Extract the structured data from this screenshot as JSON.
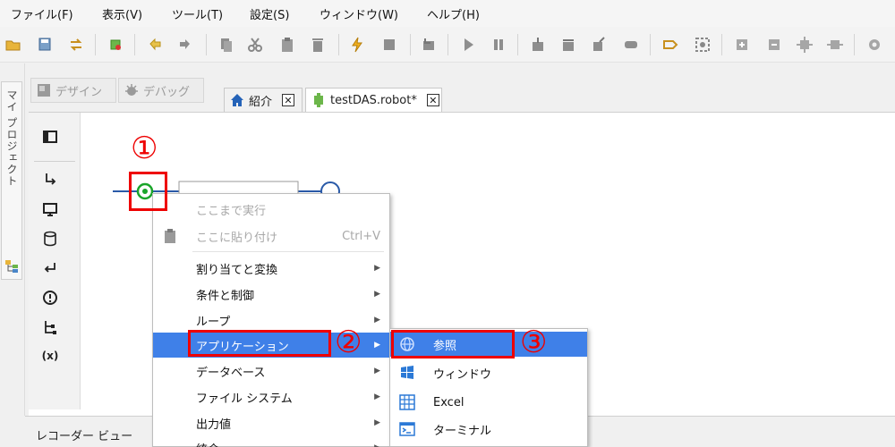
{
  "menubar": {
    "items": [
      {
        "label": "ファイル(F)"
      },
      {
        "label": "表示(V)"
      },
      {
        "label": "ツール(T)"
      },
      {
        "label": "設定(S)"
      },
      {
        "label": "ウィンドウ(W)"
      },
      {
        "label": "ヘルプ(H)"
      }
    ]
  },
  "left_panel": {
    "project_tab": "マイ プロジェクト"
  },
  "perspectives": {
    "design": "デザイン",
    "debug": "デバッグ"
  },
  "editor_tabs": [
    {
      "label": "紹介",
      "close": "✕"
    },
    {
      "label": "testDAS.robot*",
      "close": "✕"
    }
  ],
  "palette": {
    "variables_label": "(x)"
  },
  "recorder": {
    "title": "レコーダー ビュー"
  },
  "context_menu": {
    "items": [
      {
        "label": "ここまで実行",
        "shortcut": ""
      },
      {
        "label": "ここに貼り付け",
        "shortcut": "Ctrl+V"
      },
      {
        "label": "割り当てと変換",
        "arrow": "▶"
      },
      {
        "label": "条件と制御",
        "arrow": "▶"
      },
      {
        "label": "ループ",
        "arrow": "▶"
      },
      {
        "label": "アプリケーション",
        "arrow": "▶"
      },
      {
        "label": "データベース",
        "arrow": "▶"
      },
      {
        "label": "ファイル システム",
        "arrow": "▶"
      },
      {
        "label": "出力値",
        "arrow": "▶"
      },
      {
        "label": "統合",
        "arrow": "▶"
      }
    ]
  },
  "submenu": {
    "items": [
      {
        "label": "参照",
        "icon": "globe-icon"
      },
      {
        "label": "ウィンドウ",
        "icon": "windows-icon"
      },
      {
        "label": "Excel",
        "icon": "excel-grid-icon"
      },
      {
        "label": "ターミナル",
        "icon": "terminal-icon"
      }
    ]
  },
  "annotations": {
    "step1": "①",
    "step2": "②",
    "step3": "③"
  },
  "colors": {
    "highlight": "#3f80e8",
    "annotation": "#e00000",
    "flow_line": "#2a5aa8",
    "start_node": "#1aa52a"
  }
}
